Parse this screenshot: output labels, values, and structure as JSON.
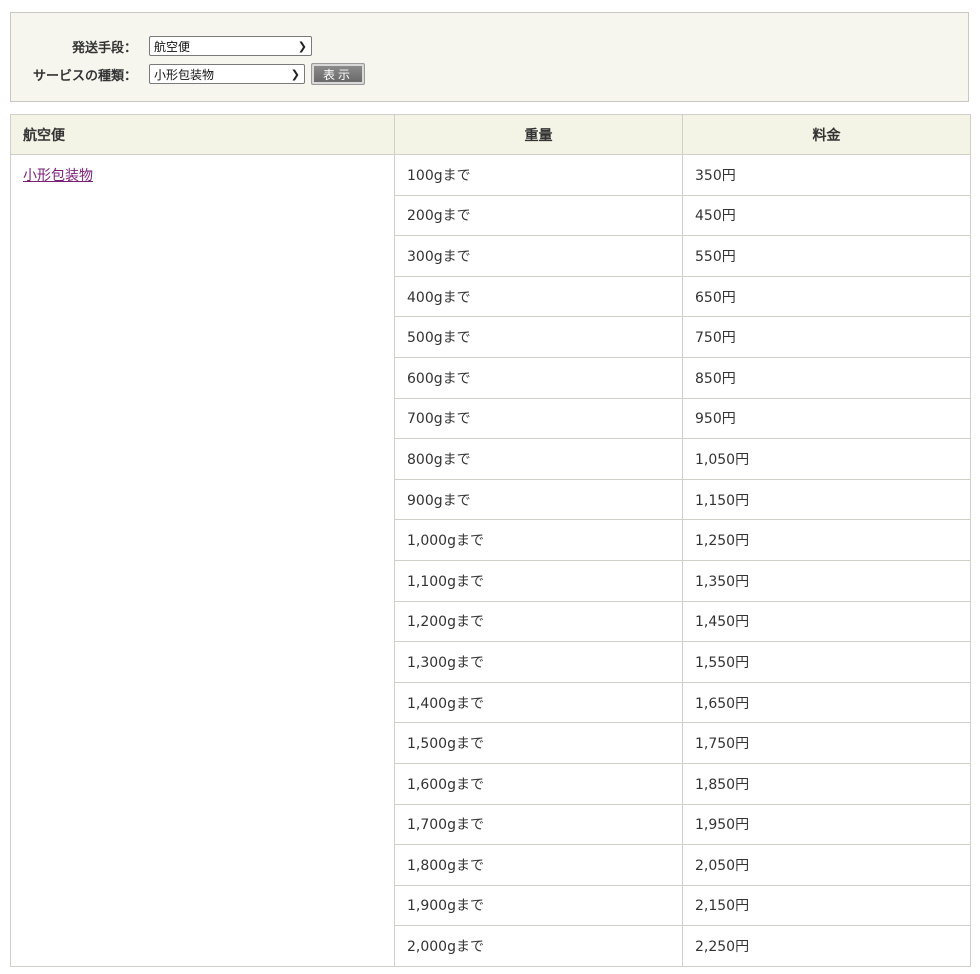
{
  "form": {
    "shipping_method_label": "発送手段：",
    "shipping_method_value": "航空便",
    "service_type_label": "サービスの種類：",
    "service_type_value": "小形包装物",
    "submit_label": "表示"
  },
  "table": {
    "headers": {
      "service": "航空便",
      "weight": "重量",
      "price": "料金"
    },
    "service_link": "小形包装物",
    "rows": [
      {
        "weight": "100gまで",
        "price": "350円"
      },
      {
        "weight": "200gまで",
        "price": "450円"
      },
      {
        "weight": "300gまで",
        "price": "550円"
      },
      {
        "weight": "400gまで",
        "price": "650円"
      },
      {
        "weight": "500gまで",
        "price": "750円"
      },
      {
        "weight": "600gまで",
        "price": "850円"
      },
      {
        "weight": "700gまで",
        "price": "950円"
      },
      {
        "weight": "800gまで",
        "price": "1,050円"
      },
      {
        "weight": "900gまで",
        "price": "1,150円"
      },
      {
        "weight": "1,000gまで",
        "price": "1,250円"
      },
      {
        "weight": "1,100gまで",
        "price": "1,350円"
      },
      {
        "weight": "1,200gまで",
        "price": "1,450円"
      },
      {
        "weight": "1,300gまで",
        "price": "1,550円"
      },
      {
        "weight": "1,400gまで",
        "price": "1,650円"
      },
      {
        "weight": "1,500gまで",
        "price": "1,750円"
      },
      {
        "weight": "1,600gまで",
        "price": "1,850円"
      },
      {
        "weight": "1,700gまで",
        "price": "1,950円"
      },
      {
        "weight": "1,800gまで",
        "price": "2,050円"
      },
      {
        "weight": "1,900gまで",
        "price": "2,150円"
      },
      {
        "weight": "2,000gまで",
        "price": "2,250円"
      }
    ]
  },
  "icons": {
    "select_chevron": "chevron-down-icon"
  },
  "colors": {
    "panel_bg": "#f6f6ef",
    "header_bg": "#f3f3e6",
    "service_cell_bg": "#f8f8f0",
    "link": "#7a1e7a",
    "border": "#d0d0c8"
  }
}
